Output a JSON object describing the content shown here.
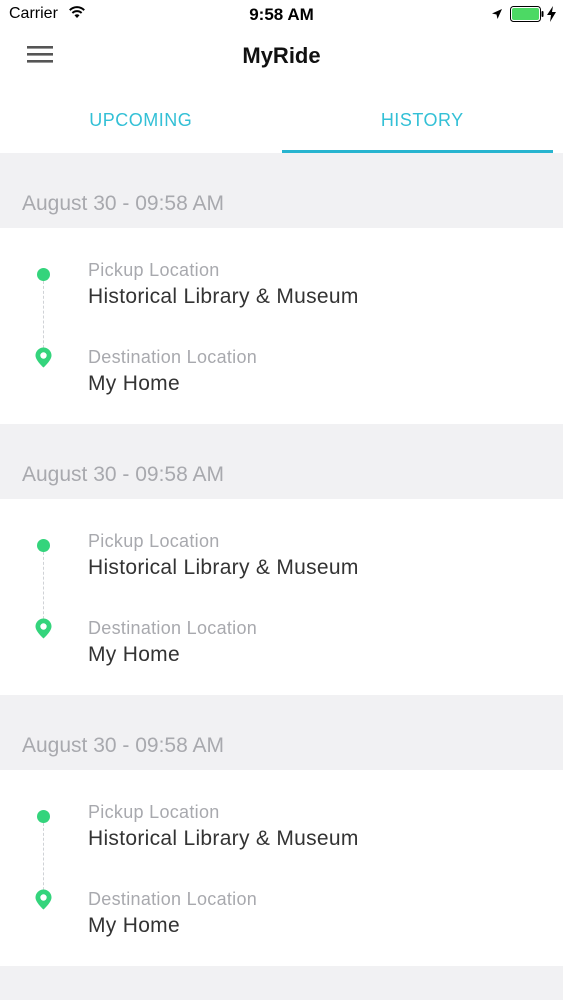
{
  "status_bar": {
    "carrier": "Carrier",
    "time": "9:58 AM"
  },
  "header": {
    "title": "MyRide",
    "menu_icon": "hamburger-menu-icon"
  },
  "tabs": [
    {
      "label": "UPCOMING",
      "active": false
    },
    {
      "label": "HISTORY",
      "active": true
    }
  ],
  "colors": {
    "accent": "#27b4cf",
    "tab_text": "#33c0d6",
    "marker_green": "#34d47c",
    "muted_text": "#a8a9ae",
    "background": "#f1f1f3"
  },
  "rides": [
    {
      "date": "August 30 - 09:58 AM",
      "pickup_label": "Pickup Location",
      "pickup": "Historical Library & Museum",
      "destination_label": "Destination Location",
      "destination": "My Home"
    },
    {
      "date": "August 30 - 09:58 AM",
      "pickup_label": "Pickup Location",
      "pickup": "Historical Library & Museum",
      "destination_label": "Destination Location",
      "destination": "My Home"
    },
    {
      "date": "August 30 - 09:58 AM",
      "pickup_label": "Pickup Location",
      "pickup": "Historical Library & Museum",
      "destination_label": "Destination Location",
      "destination": "My Home"
    }
  ]
}
